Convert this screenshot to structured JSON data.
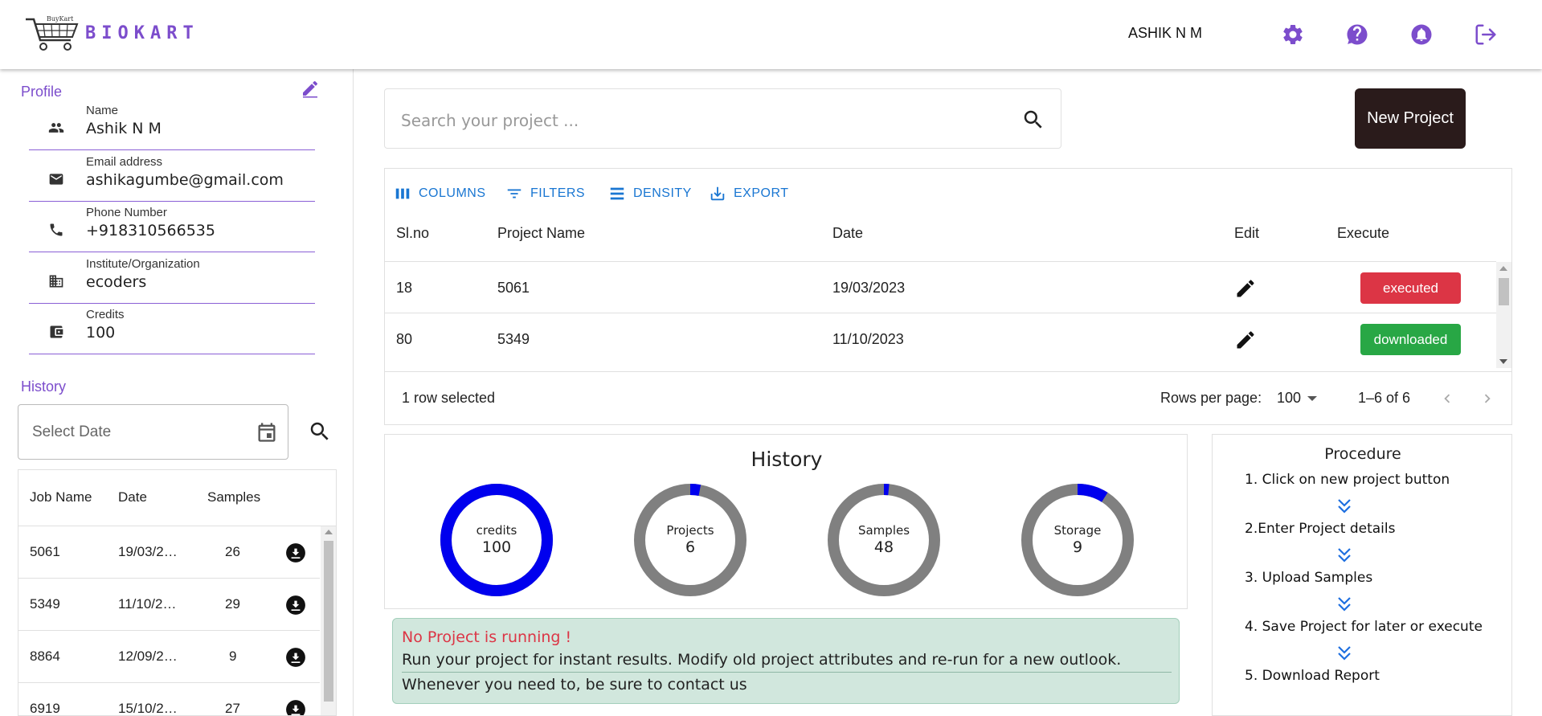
{
  "header": {
    "brand": "BIOKART",
    "logo_text": "BuyKart",
    "username": "ASHIK N M",
    "icons": [
      "gear-icon",
      "help-icon",
      "bell-icon",
      "logout-icon"
    ],
    "accent_color": "#7c4dcc"
  },
  "profile": {
    "title": "Profile",
    "fields": [
      {
        "label": "Name",
        "value": "Ashik N M",
        "icon": "people-icon"
      },
      {
        "label": "Email address",
        "value": "ashikagumbe@gmail.com",
        "icon": "mail-icon"
      },
      {
        "label": "Phone Number",
        "value": "+918310566535",
        "icon": "phone-icon"
      },
      {
        "label": "Institute/Organization",
        "value": "ecoders",
        "icon": "building-icon"
      },
      {
        "label": "Credits",
        "value": "100",
        "icon": "wallet-icon"
      }
    ]
  },
  "history_sidebar": {
    "title": "History",
    "date_placeholder": "Select Date",
    "columns": [
      "Job Name",
      "Date",
      "Samples"
    ],
    "rows": [
      {
        "job": "5061",
        "date": "19/03/2…",
        "samples": "26"
      },
      {
        "job": "5349",
        "date": "11/10/2…",
        "samples": "29"
      },
      {
        "job": "8864",
        "date": "12/09/2…",
        "samples": "9"
      },
      {
        "job": "6919",
        "date": "15/10/2…",
        "samples": "27"
      }
    ]
  },
  "search": {
    "placeholder": "Search your project ..."
  },
  "new_project_label": "New Project",
  "grid": {
    "toolbar": [
      "COLUMNS",
      "FILTERS",
      "DENSITY",
      "EXPORT"
    ],
    "columns": [
      "Sl.no",
      "Project Name",
      "Date",
      "Edit",
      "Execute"
    ],
    "rows": [
      {
        "slno": "18",
        "name": "5061",
        "date": "19/03/2023",
        "status": "executed",
        "status_color": "#dc3545"
      },
      {
        "slno": "80",
        "name": "5349",
        "date": "11/10/2023",
        "status": "downloaded",
        "status_color": "#28a745"
      }
    ],
    "selected_text": "1 row selected",
    "rows_per_page_label": "Rows per page:",
    "rows_per_page": "100",
    "range": "1–6 of 6"
  },
  "history_chart": {
    "title": "History",
    "donuts": [
      {
        "label": "credits",
        "value": "100",
        "fraction": 1.0,
        "color": "#0000ee"
      },
      {
        "label": "Projects",
        "value": "6",
        "fraction": 0.03,
        "color": "#0000ee"
      },
      {
        "label": "Samples",
        "value": "48",
        "fraction": 0.015,
        "color": "#0000ee"
      },
      {
        "label": "Storage",
        "value": "9",
        "fraction": 0.09,
        "color": "#0000ee"
      }
    ],
    "track_color": "#808080"
  },
  "alert": {
    "title": "No Project is running !",
    "line1": "Run your project for instant results. Modify old project attributes and re-run for a new outlook.",
    "line2": "Whenever you need to, be sure to contact us"
  },
  "procedure": {
    "title": "Procedure",
    "steps": [
      "1. Click on new project button",
      "2.Enter Project details",
      "3. Upload Samples",
      "4. Save Project for later or execute",
      "5. Download Report"
    ]
  }
}
